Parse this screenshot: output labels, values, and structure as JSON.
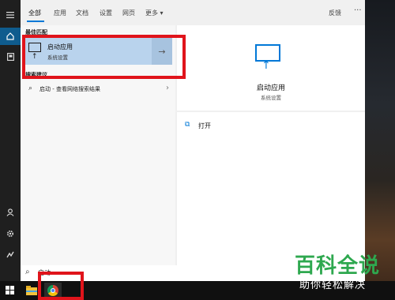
{
  "tabs": [
    "全部",
    "应用",
    "文档",
    "设置",
    "网页",
    "更多 ▾"
  ],
  "feedback": "反馈",
  "more_dots": "···",
  "results": {
    "best_match_header": "最佳匹配",
    "best_match": {
      "title": "启动应用",
      "subtitle": "系统设置"
    },
    "web_header": "搜索建议",
    "web_item": "启动 - 查看网络搜索结果"
  },
  "detail": {
    "title": "启动应用",
    "subtitle": "系统设置",
    "open_label": "打开"
  },
  "search": {
    "query": "启动"
  },
  "watermark": {
    "title": "百科全说",
    "subtitle": "助你轻松解决"
  },
  "colors": {
    "accent": "#0078d7",
    "highlight": "#b9d3ed",
    "annotation": "#e0141b",
    "brand": "#2ea84f"
  }
}
